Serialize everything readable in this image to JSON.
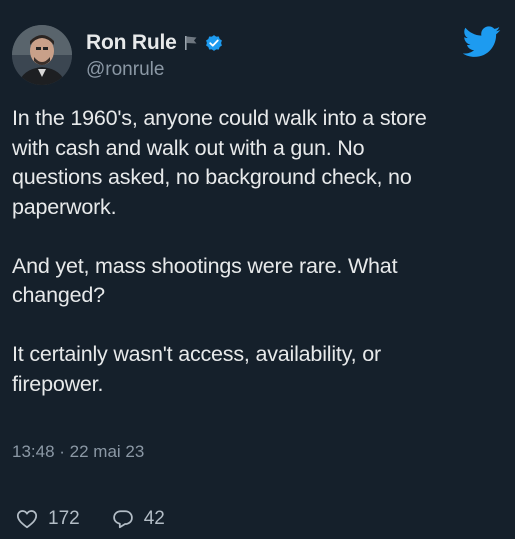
{
  "tweet": {
    "display_name": "Ron Rule",
    "handle": "@ronrule",
    "paragraphs": [
      "In the 1960's, anyone could walk into a store\nwith cash and walk out with a gun. No\nquestions asked, no background check, no\npaperwork.",
      "And yet, mass shootings were rare. What\nchanged?",
      "It certainly wasn't access, availability, or\nfirepower."
    ],
    "timestamp": "13:48 · 22 mai 23",
    "likes": "172",
    "replies": "42"
  },
  "icons": {
    "avatar": "profile-photo",
    "flag": "flag-icon",
    "verified": "verified-badge-icon",
    "brand": "twitter-bird-icon",
    "like": "heart-icon",
    "reply": "reply-bubble-icon"
  },
  "colors": {
    "background": "#15202b",
    "text": "#e7e9ea",
    "secondary_text": "#8b98a5",
    "brand_blue": "#1d9bf0"
  }
}
